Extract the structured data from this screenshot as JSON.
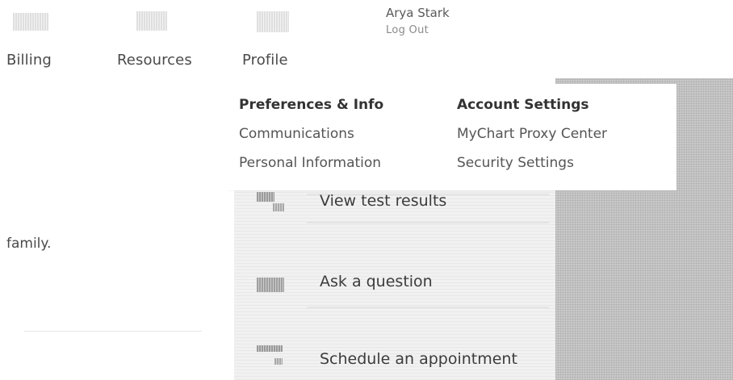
{
  "nav": {
    "items": [
      {
        "label": "Billing",
        "icon": "billing-icon"
      },
      {
        "label": "Resources",
        "icon": "resources-icon"
      },
      {
        "label": "Profile",
        "icon": "profile-icon"
      }
    ],
    "user": {
      "name": "Arya Stark",
      "logout": "Log Out"
    }
  },
  "profile_menu": {
    "columns": [
      {
        "heading": "Preferences & Info",
        "links": [
          "Communications",
          "Personal Information"
        ]
      },
      {
        "heading": "Account Settings",
        "links": [
          "MyChart Proxy Center",
          "Security Settings"
        ]
      }
    ]
  },
  "body": {
    "partial_text": "family."
  },
  "quick_actions": [
    {
      "label": "View test results",
      "icon": "test-results-icon"
    },
    {
      "label": "Ask a question",
      "icon": "message-icon"
    },
    {
      "label": "Schedule an appointment",
      "icon": "calendar-icon"
    }
  ]
}
